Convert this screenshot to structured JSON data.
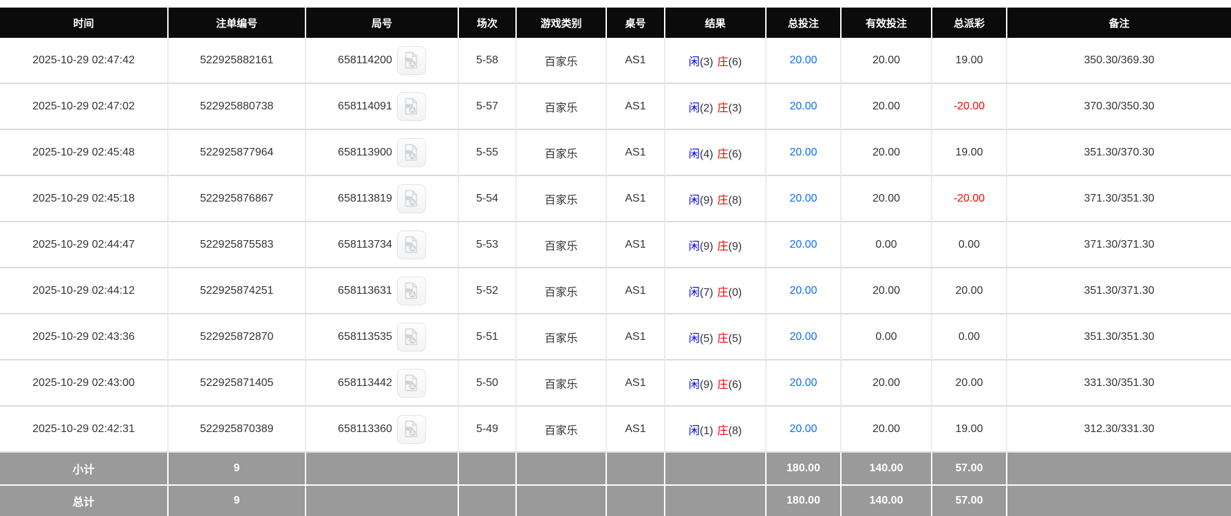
{
  "table": {
    "columns": [
      "时间",
      "注单编号",
      "局号",
      "场次",
      "游戏类别",
      "桌号",
      "结果",
      "总投注",
      "有效投注",
      "总派彩",
      "备注"
    ],
    "rows": [
      {
        "time": "2025-10-29 02:47:42",
        "bet_id": "522925882161",
        "round_no": "658114200",
        "session": "5-58",
        "game_type": "百家乐",
        "table_no": "AS1",
        "result": {
          "player_label": "闲",
          "player_score": "(3)",
          "banker_label": "庄",
          "banker_score": "(6)"
        },
        "total_bet": "20.00",
        "valid_bet": "20.00",
        "payout": "19.00",
        "remark": "350.30/369.30"
      },
      {
        "time": "2025-10-29 02:47:02",
        "bet_id": "522925880738",
        "round_no": "658114091",
        "session": "5-57",
        "game_type": "百家乐",
        "table_no": "AS1",
        "result": {
          "player_label": "闲",
          "player_score": "(2)",
          "banker_label": "庄",
          "banker_score": "(3)"
        },
        "total_bet": "20.00",
        "valid_bet": "20.00",
        "payout": "-20.00",
        "remark": "370.30/350.30"
      },
      {
        "time": "2025-10-29 02:45:48",
        "bet_id": "522925877964",
        "round_no": "658113900",
        "session": "5-55",
        "game_type": "百家乐",
        "table_no": "AS1",
        "result": {
          "player_label": "闲",
          "player_score": "(4)",
          "banker_label": "庄",
          "banker_score": "(6)"
        },
        "total_bet": "20.00",
        "valid_bet": "20.00",
        "payout": "19.00",
        "remark": "351.30/370.30"
      },
      {
        "time": "2025-10-29 02:45:18",
        "bet_id": "522925876867",
        "round_no": "658113819",
        "session": "5-54",
        "game_type": "百家乐",
        "table_no": "AS1",
        "result": {
          "player_label": "闲",
          "player_score": "(9)",
          "banker_label": "庄",
          "banker_score": "(8)"
        },
        "total_bet": "20.00",
        "valid_bet": "20.00",
        "payout": "-20.00",
        "remark": "371.30/351.30"
      },
      {
        "time": "2025-10-29 02:44:47",
        "bet_id": "522925875583",
        "round_no": "658113734",
        "session": "5-53",
        "game_type": "百家乐",
        "table_no": "AS1",
        "result": {
          "player_label": "闲",
          "player_score": "(9)",
          "banker_label": "庄",
          "banker_score": "(9)"
        },
        "total_bet": "20.00",
        "valid_bet": "0.00",
        "payout": "0.00",
        "remark": "371.30/371.30"
      },
      {
        "time": "2025-10-29 02:44:12",
        "bet_id": "522925874251",
        "round_no": "658113631",
        "session": "5-52",
        "game_type": "百家乐",
        "table_no": "AS1",
        "result": {
          "player_label": "闲",
          "player_score": "(7)",
          "banker_label": "庄",
          "banker_score": "(0)"
        },
        "total_bet": "20.00",
        "valid_bet": "20.00",
        "payout": "20.00",
        "remark": "351.30/371.30"
      },
      {
        "time": "2025-10-29 02:43:36",
        "bet_id": "522925872870",
        "round_no": "658113535",
        "session": "5-51",
        "game_type": "百家乐",
        "table_no": "AS1",
        "result": {
          "player_label": "闲",
          "player_score": "(5)",
          "banker_label": "庄",
          "banker_score": "(5)"
        },
        "total_bet": "20.00",
        "valid_bet": "0.00",
        "payout": "0.00",
        "remark": "351.30/351.30"
      },
      {
        "time": "2025-10-29 02:43:00",
        "bet_id": "522925871405",
        "round_no": "658113442",
        "session": "5-50",
        "game_type": "百家乐",
        "table_no": "AS1",
        "result": {
          "player_label": "闲",
          "player_score": "(9)",
          "banker_label": "庄",
          "banker_score": "(6)"
        },
        "total_bet": "20.00",
        "valid_bet": "20.00",
        "payout": "20.00",
        "remark": "331.30/351.30"
      },
      {
        "time": "2025-10-29 02:42:31",
        "bet_id": "522925870389",
        "round_no": "658113360",
        "session": "5-49",
        "game_type": "百家乐",
        "table_no": "AS1",
        "result": {
          "player_label": "闲",
          "player_score": "(1)",
          "banker_label": "庄",
          "banker_score": "(8)"
        },
        "total_bet": "20.00",
        "valid_bet": "20.00",
        "payout": "19.00",
        "remark": "312.30/331.30"
      }
    ],
    "subtotal": {
      "label": "小计",
      "count": "9",
      "total_bet": "180.00",
      "valid_bet": "140.00",
      "payout": "57.00"
    },
    "total": {
      "label": "总计",
      "count": "9",
      "total_bet": "180.00",
      "valid_bet": "140.00",
      "payout": "57.00"
    }
  },
  "icons": {
    "round_column_icon": "video-replay-icon"
  },
  "colors": {
    "header_bg": "#0b0b0b",
    "header_text": "#ffffff",
    "link_blue": "#0c6efc",
    "player_blue": "#0000ee",
    "banker_red": "#ee0000",
    "negative_red": "#ff0000",
    "summary_bg": "#9a9a9a",
    "row_text": "#333333"
  }
}
